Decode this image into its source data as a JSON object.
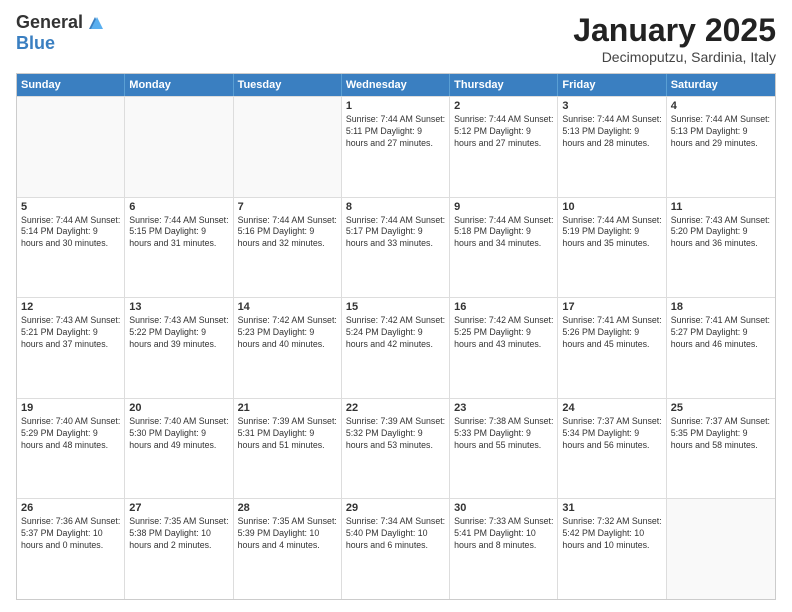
{
  "logo": {
    "general": "General",
    "blue": "Blue"
  },
  "title": "January 2025",
  "subtitle": "Decimoputzu, Sardinia, Italy",
  "header_days": [
    "Sunday",
    "Monday",
    "Tuesday",
    "Wednesday",
    "Thursday",
    "Friday",
    "Saturday"
  ],
  "rows": [
    [
      {
        "day": "",
        "text": "",
        "empty": true
      },
      {
        "day": "",
        "text": "",
        "empty": true
      },
      {
        "day": "",
        "text": "",
        "empty": true
      },
      {
        "day": "1",
        "text": "Sunrise: 7:44 AM\nSunset: 5:11 PM\nDaylight: 9 hours and 27 minutes.",
        "empty": false
      },
      {
        "day": "2",
        "text": "Sunrise: 7:44 AM\nSunset: 5:12 PM\nDaylight: 9 hours and 27 minutes.",
        "empty": false
      },
      {
        "day": "3",
        "text": "Sunrise: 7:44 AM\nSunset: 5:13 PM\nDaylight: 9 hours and 28 minutes.",
        "empty": false
      },
      {
        "day": "4",
        "text": "Sunrise: 7:44 AM\nSunset: 5:13 PM\nDaylight: 9 hours and 29 minutes.",
        "empty": false
      }
    ],
    [
      {
        "day": "5",
        "text": "Sunrise: 7:44 AM\nSunset: 5:14 PM\nDaylight: 9 hours and 30 minutes.",
        "empty": false
      },
      {
        "day": "6",
        "text": "Sunrise: 7:44 AM\nSunset: 5:15 PM\nDaylight: 9 hours and 31 minutes.",
        "empty": false
      },
      {
        "day": "7",
        "text": "Sunrise: 7:44 AM\nSunset: 5:16 PM\nDaylight: 9 hours and 32 minutes.",
        "empty": false
      },
      {
        "day": "8",
        "text": "Sunrise: 7:44 AM\nSunset: 5:17 PM\nDaylight: 9 hours and 33 minutes.",
        "empty": false
      },
      {
        "day": "9",
        "text": "Sunrise: 7:44 AM\nSunset: 5:18 PM\nDaylight: 9 hours and 34 minutes.",
        "empty": false
      },
      {
        "day": "10",
        "text": "Sunrise: 7:44 AM\nSunset: 5:19 PM\nDaylight: 9 hours and 35 minutes.",
        "empty": false
      },
      {
        "day": "11",
        "text": "Sunrise: 7:43 AM\nSunset: 5:20 PM\nDaylight: 9 hours and 36 minutes.",
        "empty": false
      }
    ],
    [
      {
        "day": "12",
        "text": "Sunrise: 7:43 AM\nSunset: 5:21 PM\nDaylight: 9 hours and 37 minutes.",
        "empty": false
      },
      {
        "day": "13",
        "text": "Sunrise: 7:43 AM\nSunset: 5:22 PM\nDaylight: 9 hours and 39 minutes.",
        "empty": false
      },
      {
        "day": "14",
        "text": "Sunrise: 7:42 AM\nSunset: 5:23 PM\nDaylight: 9 hours and 40 minutes.",
        "empty": false
      },
      {
        "day": "15",
        "text": "Sunrise: 7:42 AM\nSunset: 5:24 PM\nDaylight: 9 hours and 42 minutes.",
        "empty": false
      },
      {
        "day": "16",
        "text": "Sunrise: 7:42 AM\nSunset: 5:25 PM\nDaylight: 9 hours and 43 minutes.",
        "empty": false
      },
      {
        "day": "17",
        "text": "Sunrise: 7:41 AM\nSunset: 5:26 PM\nDaylight: 9 hours and 45 minutes.",
        "empty": false
      },
      {
        "day": "18",
        "text": "Sunrise: 7:41 AM\nSunset: 5:27 PM\nDaylight: 9 hours and 46 minutes.",
        "empty": false
      }
    ],
    [
      {
        "day": "19",
        "text": "Sunrise: 7:40 AM\nSunset: 5:29 PM\nDaylight: 9 hours and 48 minutes.",
        "empty": false
      },
      {
        "day": "20",
        "text": "Sunrise: 7:40 AM\nSunset: 5:30 PM\nDaylight: 9 hours and 49 minutes.",
        "empty": false
      },
      {
        "day": "21",
        "text": "Sunrise: 7:39 AM\nSunset: 5:31 PM\nDaylight: 9 hours and 51 minutes.",
        "empty": false
      },
      {
        "day": "22",
        "text": "Sunrise: 7:39 AM\nSunset: 5:32 PM\nDaylight: 9 hours and 53 minutes.",
        "empty": false
      },
      {
        "day": "23",
        "text": "Sunrise: 7:38 AM\nSunset: 5:33 PM\nDaylight: 9 hours and 55 minutes.",
        "empty": false
      },
      {
        "day": "24",
        "text": "Sunrise: 7:37 AM\nSunset: 5:34 PM\nDaylight: 9 hours and 56 minutes.",
        "empty": false
      },
      {
        "day": "25",
        "text": "Sunrise: 7:37 AM\nSunset: 5:35 PM\nDaylight: 9 hours and 58 minutes.",
        "empty": false
      }
    ],
    [
      {
        "day": "26",
        "text": "Sunrise: 7:36 AM\nSunset: 5:37 PM\nDaylight: 10 hours and 0 minutes.",
        "empty": false
      },
      {
        "day": "27",
        "text": "Sunrise: 7:35 AM\nSunset: 5:38 PM\nDaylight: 10 hours and 2 minutes.",
        "empty": false
      },
      {
        "day": "28",
        "text": "Sunrise: 7:35 AM\nSunset: 5:39 PM\nDaylight: 10 hours and 4 minutes.",
        "empty": false
      },
      {
        "day": "29",
        "text": "Sunrise: 7:34 AM\nSunset: 5:40 PM\nDaylight: 10 hours and 6 minutes.",
        "empty": false
      },
      {
        "day": "30",
        "text": "Sunrise: 7:33 AM\nSunset: 5:41 PM\nDaylight: 10 hours and 8 minutes.",
        "empty": false
      },
      {
        "day": "31",
        "text": "Sunrise: 7:32 AM\nSunset: 5:42 PM\nDaylight: 10 hours and 10 minutes.",
        "empty": false
      },
      {
        "day": "",
        "text": "",
        "empty": true
      }
    ]
  ]
}
